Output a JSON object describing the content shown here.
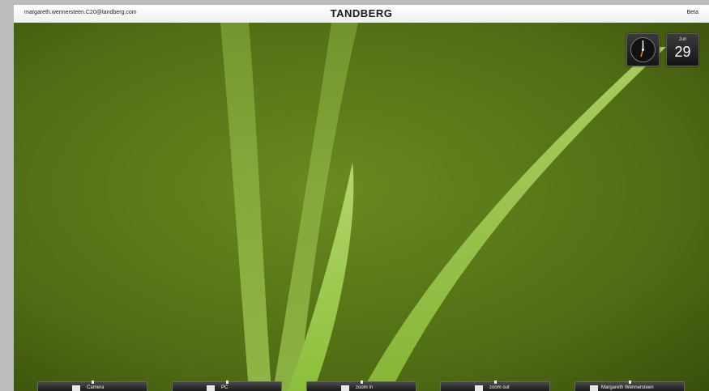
{
  "topbar": {
    "user": "margareth.wennersteen.C20@tandberg.com",
    "brand": "TANDBERG",
    "beta": "Beta"
  },
  "widgets": {
    "clock_icon": "analog-clock-icon",
    "calendar": {
      "month": "Jun",
      "day": "29"
    }
  },
  "taskbar": {
    "items": [
      {
        "label": "Camera",
        "icon": "camera-icon"
      },
      {
        "label": "PC",
        "icon": "pc-icon"
      },
      {
        "label": "zoom in",
        "icon": "zoom-in-icon"
      },
      {
        "label": "zoom out",
        "icon": "zoom-out-icon"
      },
      {
        "label": "Margareth Wennersteen",
        "icon": "phone-icon"
      }
    ]
  }
}
